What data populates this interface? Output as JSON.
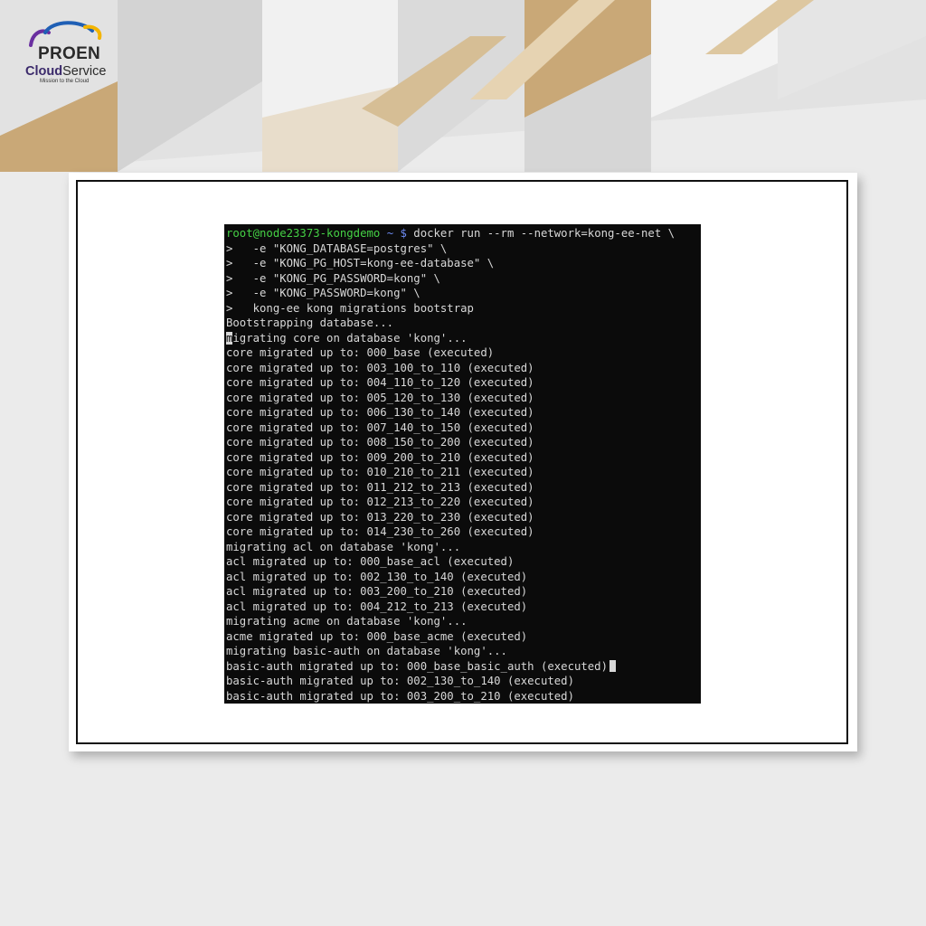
{
  "logo": {
    "brand": "PROEN",
    "sub_bold": "Cloud",
    "sub_rest": "Service",
    "tagline": "Mission to the Cloud"
  },
  "terminal": {
    "prompt_user": "root@node23373-kongdemo",
    "prompt_path": "~ $",
    "first_command": " docker run --rm --network=kong-ee-net \\",
    "continuation_lines": [
      ">   -e \"KONG_DATABASE=postgres\" \\",
      ">   -e \"KONG_PG_HOST=kong-ee-database\" \\",
      ">   -e \"KONG_PG_PASSWORD=kong\" \\",
      ">   -e \"KONG_PASSWORD=kong\" \\",
      ">   kong-ee kong migrations bootstrap"
    ],
    "bootstrapping": "Bootstrapping database...",
    "migrating_core_first_char": "m",
    "migrating_core_rest": "igrating core on database 'kong'...",
    "core_lines": [
      "core migrated up to: 000_base (executed)",
      "core migrated up to: 003_100_to_110 (executed)",
      "core migrated up to: 004_110_to_120 (executed)",
      "core migrated up to: 005_120_to_130 (executed)",
      "core migrated up to: 006_130_to_140 (executed)",
      "core migrated up to: 007_140_to_150 (executed)",
      "core migrated up to: 008_150_to_200 (executed)",
      "core migrated up to: 009_200_to_210 (executed)",
      "core migrated up to: 010_210_to_211 (executed)",
      "core migrated up to: 011_212_to_213 (executed)",
      "core migrated up to: 012_213_to_220 (executed)",
      "core migrated up to: 013_220_to_230 (executed)",
      "core migrated up to: 014_230_to_260 (executed)"
    ],
    "migrating_acl": "migrating acl on database 'kong'...",
    "acl_lines": [
      "acl migrated up to: 000_base_acl (executed)",
      "acl migrated up to: 002_130_to_140 (executed)",
      "acl migrated up to: 003_200_to_210 (executed)",
      "acl migrated up to: 004_212_to_213 (executed)"
    ],
    "migrating_acme": "migrating acme on database 'kong'...",
    "acme_line": "acme migrated up to: 000_base_acme (executed)",
    "migrating_basic_auth": "migrating basic-auth on database 'kong'...",
    "basic_auth_line_with_cursor": "basic-auth migrated up to: 000_base_basic_auth (executed)",
    "basic_auth_lines": [
      "basic-auth migrated up to: 002_130_to_140 (executed)",
      "basic-auth migrated up to: 003_200_to_210 (executed)"
    ]
  },
  "colors": {
    "prompt_user": "#45d145",
    "prompt_path": "#6d8bf2",
    "terminal_bg": "#0b0b0b",
    "terminal_text": "#d8d8d8",
    "accent_gold": "#c9a877"
  }
}
